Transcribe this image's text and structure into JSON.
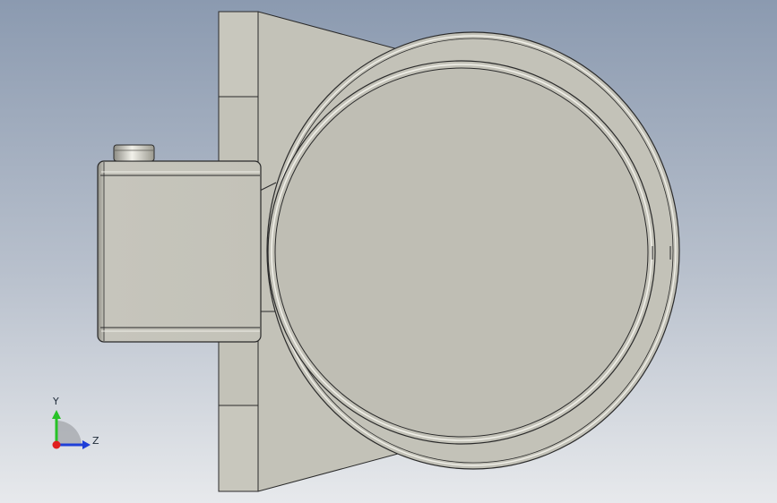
{
  "viewport": {
    "background_top": "#8b9ab0",
    "background_bottom": "#e7e9ec",
    "part_fill": "#c3c2b8",
    "part_fill_light": "#cfcec5",
    "part_edge": "#2a2a2a"
  },
  "triad": {
    "y_label": "Y",
    "z_label": "Z",
    "y_color": "#27c227",
    "z_color": "#1f3fd8",
    "x_color": "#e01e1e"
  }
}
